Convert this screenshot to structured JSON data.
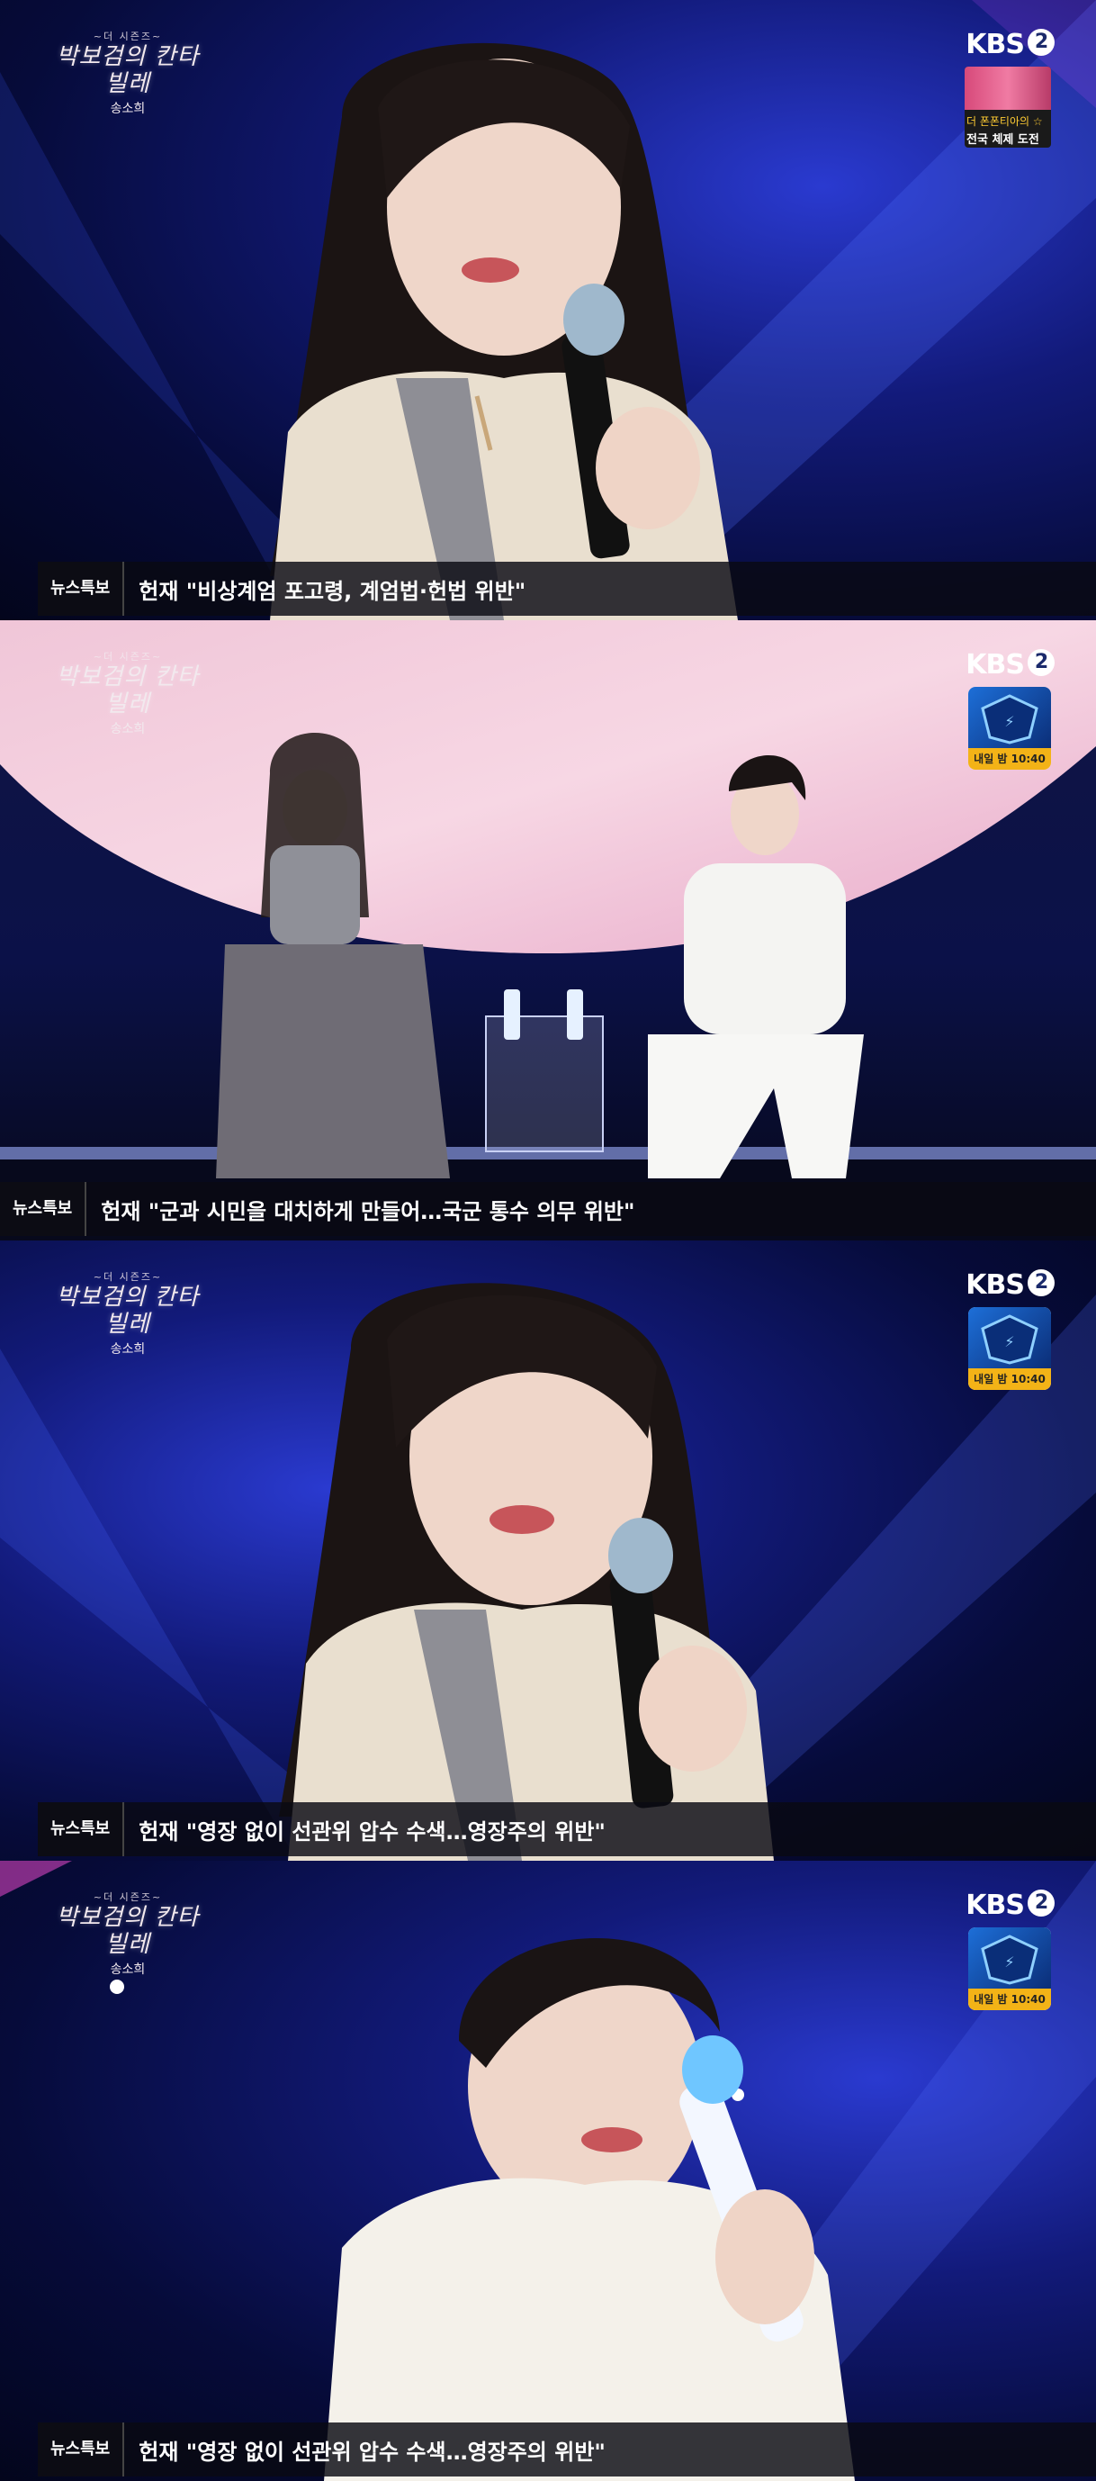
{
  "show": {
    "logo_small": "~더 시즌즈~",
    "logo_title": "박보검의 칸타빌레",
    "guest": "송소희"
  },
  "channel": {
    "logo_text": "KBS",
    "logo_number": "2"
  },
  "promo_frame1": {
    "line1": "더 폰폰티아의 ☆",
    "line2": "전국 체제 도전"
  },
  "promo": {
    "schedule": "내일 밤 10:40"
  },
  "news": {
    "tag": "뉴스특보",
    "frames": [
      {
        "headline": "헌재 \"비상계엄 포고령, 계엄법·헌법 위반\""
      },
      {
        "headline": "헌재 \"군과 시민을 대치하게 만들어…국군 통수 의무 위반\""
      },
      {
        "headline": "헌재 \"영장 없이 선관위 압수 수색…영장주의 위반\""
      },
      {
        "headline": "헌재 \"영장 없이 선관위 압수 수색…영장주의 위반\""
      }
    ]
  },
  "colors": {
    "stage_blue": "#1a2a9a",
    "stage_dark": "#050a2e",
    "promo_yellow": "#f3b317",
    "ticker_bg": "#0a0a12"
  },
  "icons": [
    "show-logo-icon",
    "kbs2-logo-icon",
    "promo-thumbnail-icon"
  ]
}
